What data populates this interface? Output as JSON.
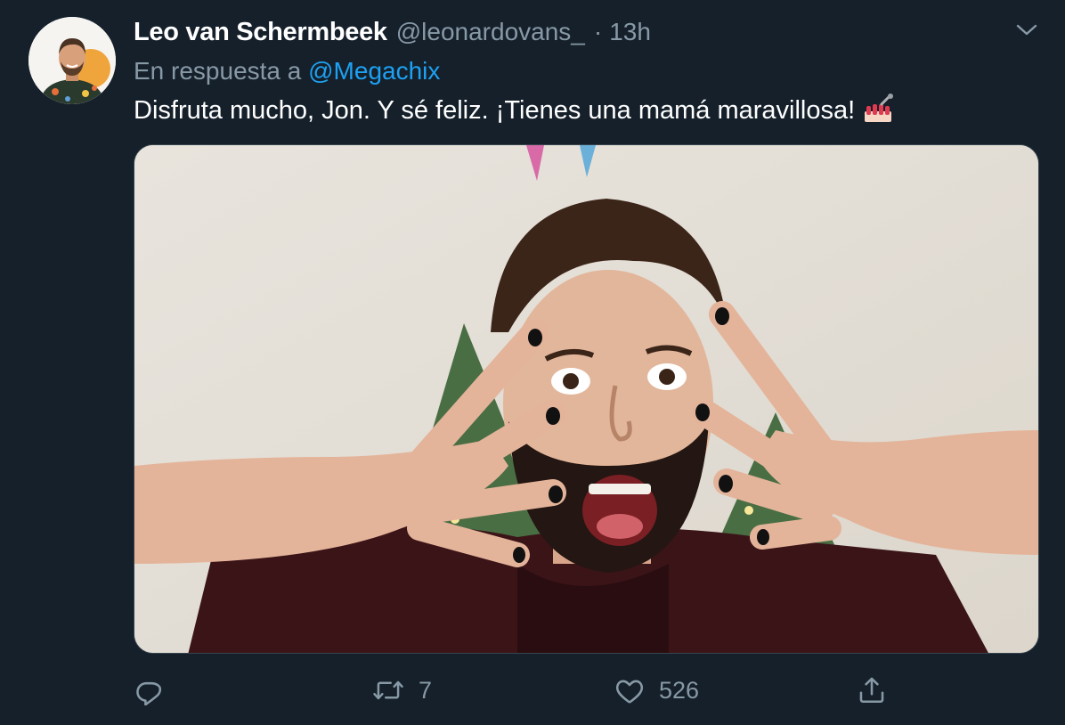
{
  "tweet": {
    "author": {
      "display_name": "Leo van Schermbeek",
      "handle": "@leonardovans_",
      "separator": "·",
      "time": "13h",
      "avatar_icon": "user-avatar"
    },
    "reply_prefix": "En respuesta a",
    "reply_to": "@Megachix",
    "text": "Disfruta mucho, Jon. Y sé feliz. ¡Tienes una mamá maravillosa!",
    "emoji": "nail-polish-emoji",
    "media": {
      "type": "photo",
      "icon": "photo"
    },
    "actions": {
      "reply": {
        "icon": "reply-icon",
        "count": ""
      },
      "retweet": {
        "icon": "retweet-icon",
        "count": "7"
      },
      "like": {
        "icon": "heart-icon",
        "count": "526"
      },
      "share": {
        "icon": "share-icon",
        "count": ""
      }
    }
  },
  "colors": {
    "background": "#15202b",
    "text_primary": "#ffffff",
    "text_secondary": "#8899a6",
    "link": "#1da1f2",
    "border": "#38444d"
  }
}
